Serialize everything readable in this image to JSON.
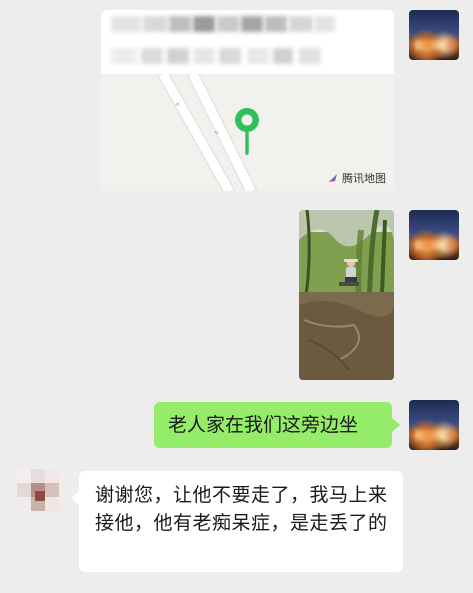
{
  "chat": {
    "location_card": {
      "map_brand_label": "腾讯地图",
      "map_brand_icon": "tencent-map-logo-icon",
      "pin_color": "#2fbf5b"
    },
    "photo_message": {
      "icon": "photo-thumbnail"
    },
    "sent_text_message": {
      "text": "老人家在我们这旁边坐"
    },
    "received_text_message": {
      "text": "谢谢您，让他不要走了，我马上来接他，他有老痴呆症，是走丢了的"
    },
    "colors": {
      "background": "#ededed",
      "sent_bubble": "#95ec69",
      "received_bubble": "#ffffff"
    }
  }
}
